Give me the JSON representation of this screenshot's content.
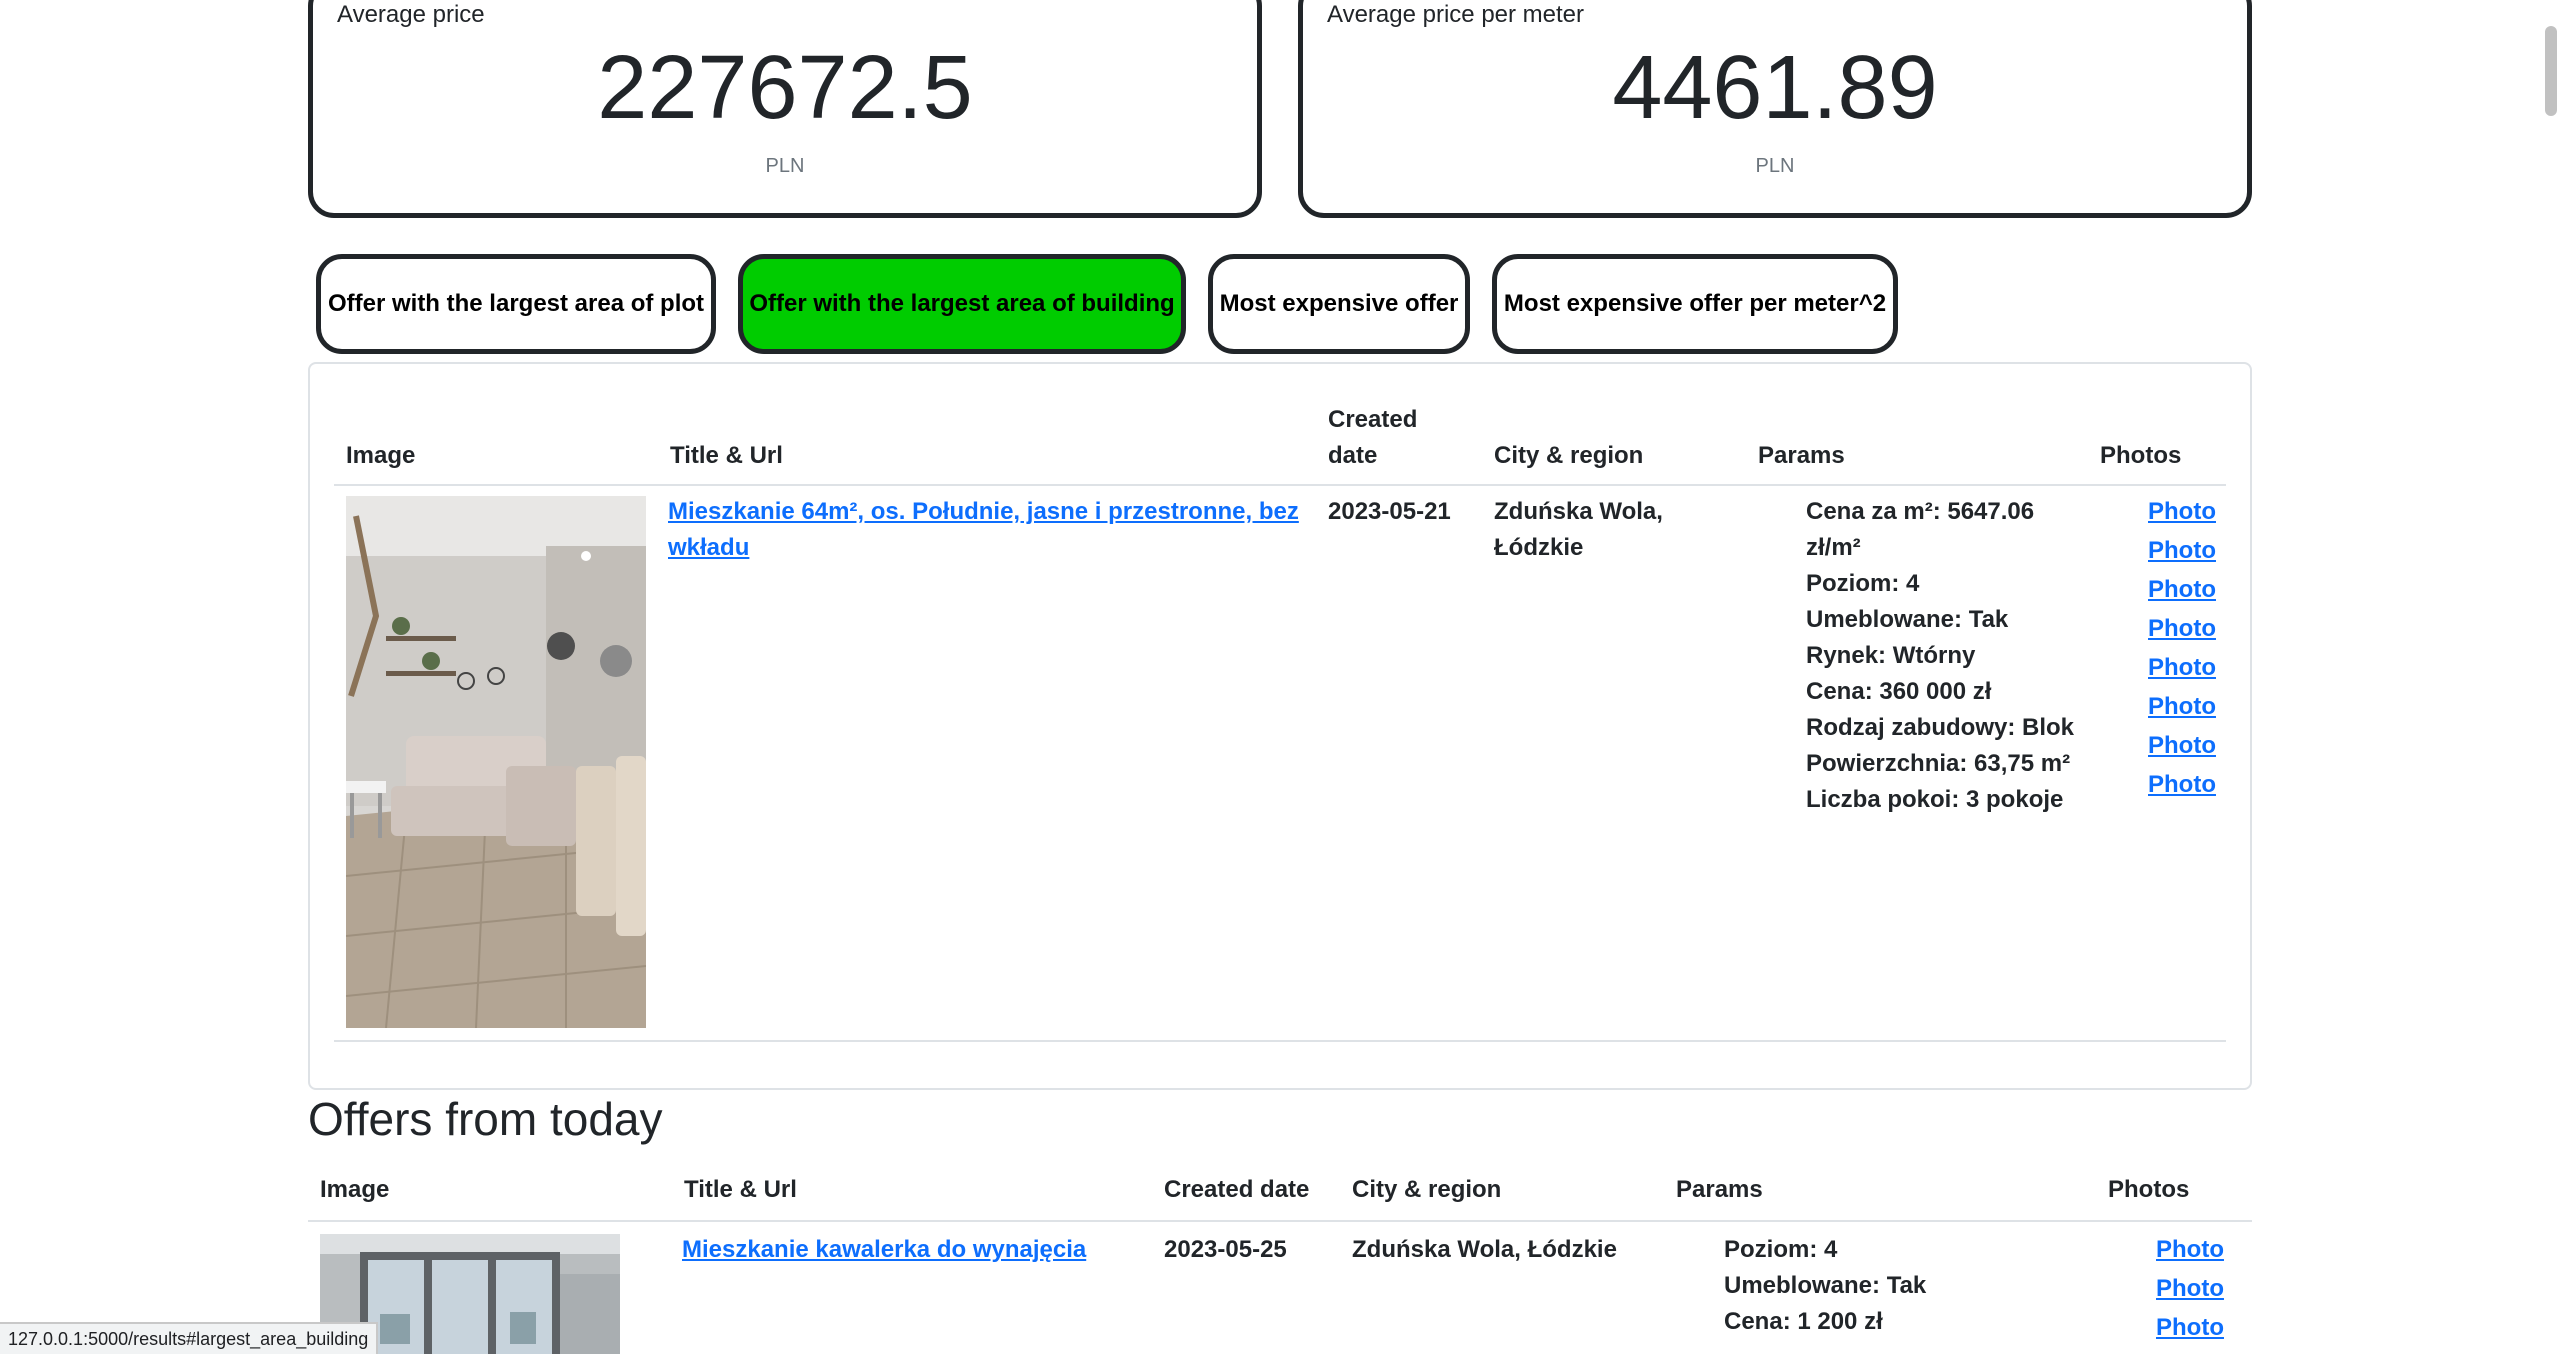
{
  "stats": {
    "avg_price": {
      "label": "Average price",
      "value": "227672.5",
      "unit": "PLN"
    },
    "avg_price_per_meter": {
      "label": "Average price per meter",
      "value": "4461.89",
      "unit": "PLN"
    }
  },
  "tabs": [
    {
      "label": "Offer with the largest area of plot",
      "active": false
    },
    {
      "label": "Offer with the largest area of building",
      "active": true
    },
    {
      "label": "Most expensive offer",
      "active": false
    },
    {
      "label": "Most expensive offer per meter^2",
      "active": false
    }
  ],
  "featured": {
    "headers": {
      "image": "Image",
      "title": "Title & Url",
      "created_line1": "Created",
      "created_line2": "date",
      "city": "City & region",
      "params": "Params",
      "photos": "Photos"
    },
    "row": {
      "title_line1": "Mieszkanie 64m², os. Południe, jasne i przestronne, bez",
      "title_line2": "wkładu",
      "created": "2023-05-21",
      "city_line1": "Zduńska Wola,",
      "city_line2": "Łódzkie",
      "params": [
        "Cena za m²: 5647.06",
        "zł/m²",
        "Poziom: 4",
        "Umeblowane: Tak",
        "Rynek: Wtórny",
        "Cena: 360 000 zł",
        "Rodzaj zabudowy: Blok",
        "Powierzchnia: 63,75 m²",
        "Liczba pokoi: 3 pokoje"
      ],
      "photos": [
        "Photo",
        "Photo",
        "Photo",
        "Photo",
        "Photo",
        "Photo",
        "Photo",
        "Photo"
      ]
    }
  },
  "today": {
    "title": "Offers from today",
    "headers": {
      "image": "Image",
      "title": "Title & Url",
      "created": "Created date",
      "city": "City & region",
      "params": "Params",
      "photos": "Photos"
    },
    "row": {
      "title": "Mieszkanie kawalerka do wynajęcia",
      "created": "2023-05-25",
      "city": "Zduńska Wola, Łódzkie",
      "params": [
        "Poziom: 4",
        "Umeblowane: Tak",
        "Cena: 1 200 zł"
      ],
      "photos": [
        "Photo",
        "Photo",
        "Photo"
      ]
    }
  },
  "status_bar": {
    "url": "127.0.0.1:5000/results#largest_area_building"
  },
  "colors": {
    "active_tab": "#00cc00",
    "link": "#0d6efd",
    "border": "#212529"
  }
}
